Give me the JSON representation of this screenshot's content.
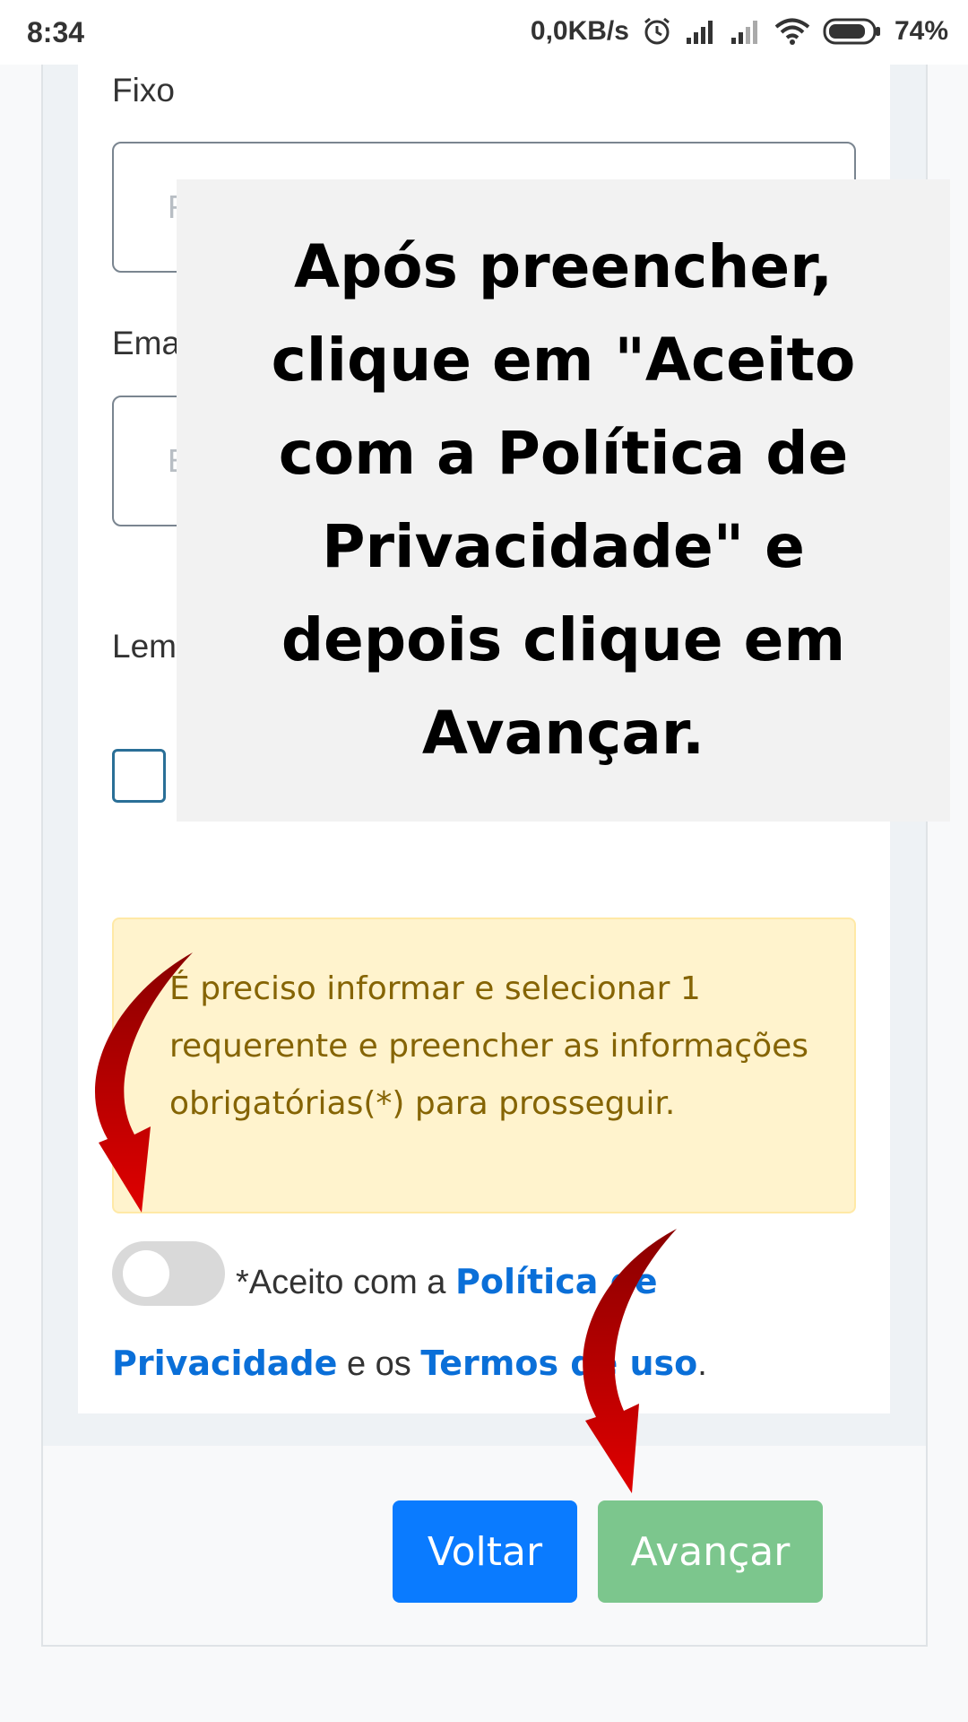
{
  "status_bar": {
    "time": "8:34",
    "network_speed": "0,0KB/s",
    "battery": "74%",
    "icons": [
      "alarm-icon",
      "signal-icon",
      "signal-weak-icon",
      "wifi-icon",
      "battery-icon"
    ]
  },
  "form": {
    "fixo_label": "Fixo",
    "fixo_placeholder": "F",
    "email_label": "Ema",
    "email_placeholder": "E",
    "remember_label": "Lem"
  },
  "alert": {
    "message": "É preciso informar e selecionar 1 requerente e preencher as informações obrigatórias(*) para prosseguir."
  },
  "consent": {
    "prefix": "*Aceito com a ",
    "policy_link": "Política de Privacidade",
    "middle": " e os ",
    "terms_link": "Termos de uso",
    "suffix": "."
  },
  "buttons": {
    "back": "Voltar",
    "next": "Avançar"
  },
  "overlay": {
    "instruction": "Após preencher, clique em \"Aceito com a Política de Privacidade\" e depois clique em Avançar."
  },
  "colors": {
    "primary": "#0a7bff",
    "next_button": "#7cc68d",
    "alert_bg": "#fff3cd",
    "alert_text": "#856404",
    "link": "#0a6fd8",
    "arrow": "#c00000"
  }
}
